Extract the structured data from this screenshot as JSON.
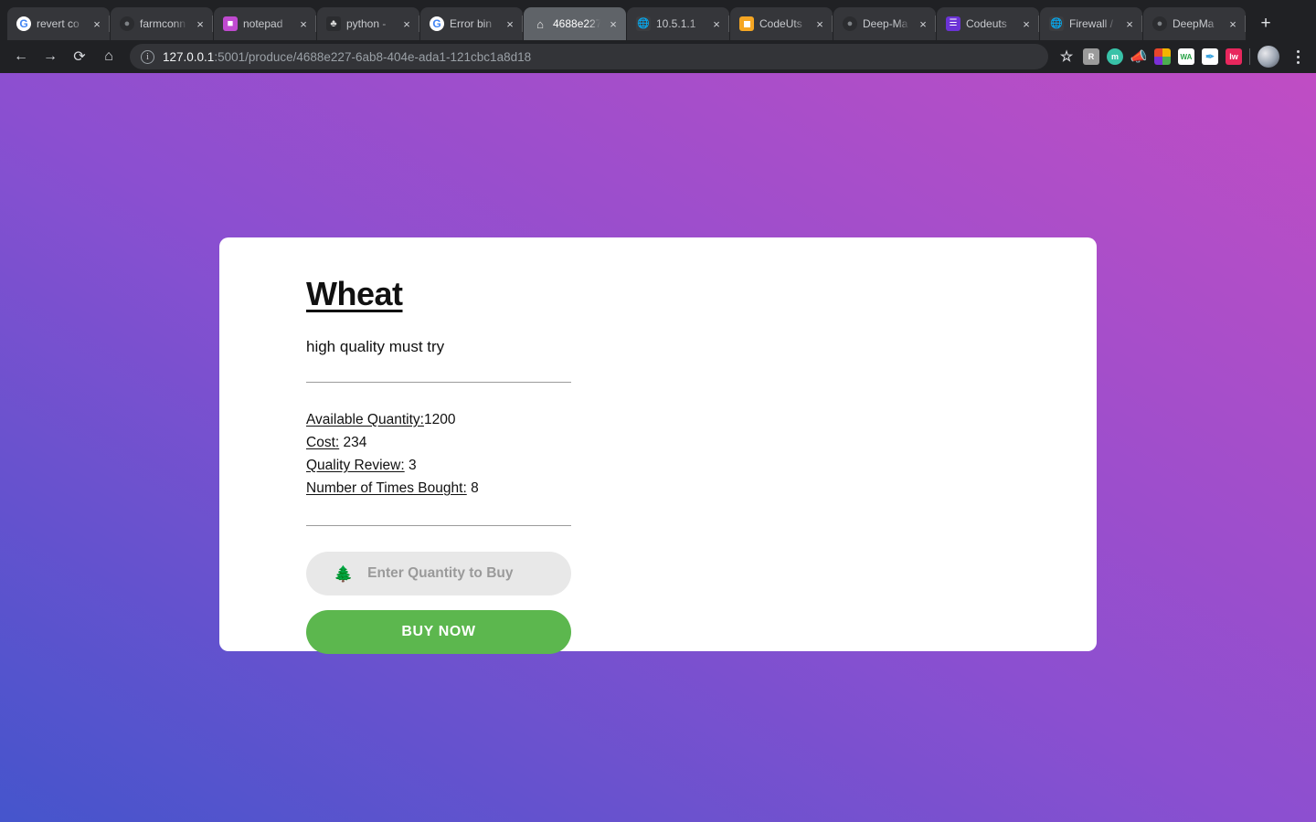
{
  "browser": {
    "tabs": [
      {
        "title": "revert co",
        "favicon": "google-icon",
        "active": false
      },
      {
        "title": "farmconn",
        "favicon": "dark-circle-icon",
        "active": false
      },
      {
        "title": "notepad",
        "favicon": "purple-note-icon",
        "active": false
      },
      {
        "title": "python -",
        "favicon": "java-icon",
        "active": false
      },
      {
        "title": "Error bin",
        "favicon": "google-icon",
        "active": false
      },
      {
        "title": "4688e227",
        "favicon": "home-icon",
        "active": true
      },
      {
        "title": "10.5.1.1",
        "favicon": "gray-globe-icon",
        "active": false
      },
      {
        "title": "CodeUts",
        "favicon": "orange-square-icon",
        "active": false
      },
      {
        "title": "Deep-Ma",
        "favicon": "dark-circle-icon",
        "active": false
      },
      {
        "title": "Codeuts",
        "favicon": "violet-list-icon",
        "active": false
      },
      {
        "title": "Firewall /",
        "favicon": "gray-globe-icon",
        "active": false
      },
      {
        "title": "DeepMa",
        "favicon": "dark-circle-icon",
        "active": false
      }
    ],
    "new_tab_label": "+",
    "close_label": "×",
    "nav": {
      "back_label": "←",
      "forward_label": "→",
      "reload_label": "⟳",
      "home_label": "⌂"
    },
    "omnibox": {
      "info_label": "i",
      "url_host": "127.0.0.1",
      "url_path": ":5001/produce/4688e227-6ab8-404e-ada1-121cbc1a8d18"
    },
    "extensions": [
      {
        "name": "bookmark-star-icon",
        "label": "☆",
        "class": "ext-star"
      },
      {
        "name": "extension-r-icon",
        "label": "R",
        "class": "ext-r"
      },
      {
        "name": "extension-m-icon",
        "label": "m",
        "class": "ext-m"
      },
      {
        "name": "extension-megaphone-icon",
        "label": "📣",
        "class": "ext-megaphone"
      },
      {
        "name": "extension-color-grid-icon",
        "label": "",
        "class": "ext-grid"
      },
      {
        "name": "extension-wa-icon",
        "label": "WA",
        "class": "ext-wa"
      },
      {
        "name": "extension-bird-icon",
        "label": "✒",
        "class": "ext-bird"
      },
      {
        "name": "extension-lw-icon",
        "label": "lw",
        "class": "ext-lw"
      }
    ]
  },
  "page": {
    "background_gradient_from": "#4555cc",
    "background_gradient_to": "#c04dc4",
    "card": {
      "title": "Wheat",
      "description": "high quality must try",
      "details": [
        {
          "label": "Available Quantity:",
          "value": "1200"
        },
        {
          "label": "Cost:",
          "value": "234"
        },
        {
          "label": "Quality Review:",
          "value": "3"
        },
        {
          "label": "Number of Times Bought:",
          "value": "8"
        }
      ],
      "quantity_input": {
        "icon": "evergreen-tree-icon",
        "icon_glyph": "🌲",
        "placeholder": "Enter Quantity to Buy",
        "value": ""
      },
      "buy_button_label": "BUY NOW",
      "buy_button_color": "#5cb74e"
    }
  }
}
